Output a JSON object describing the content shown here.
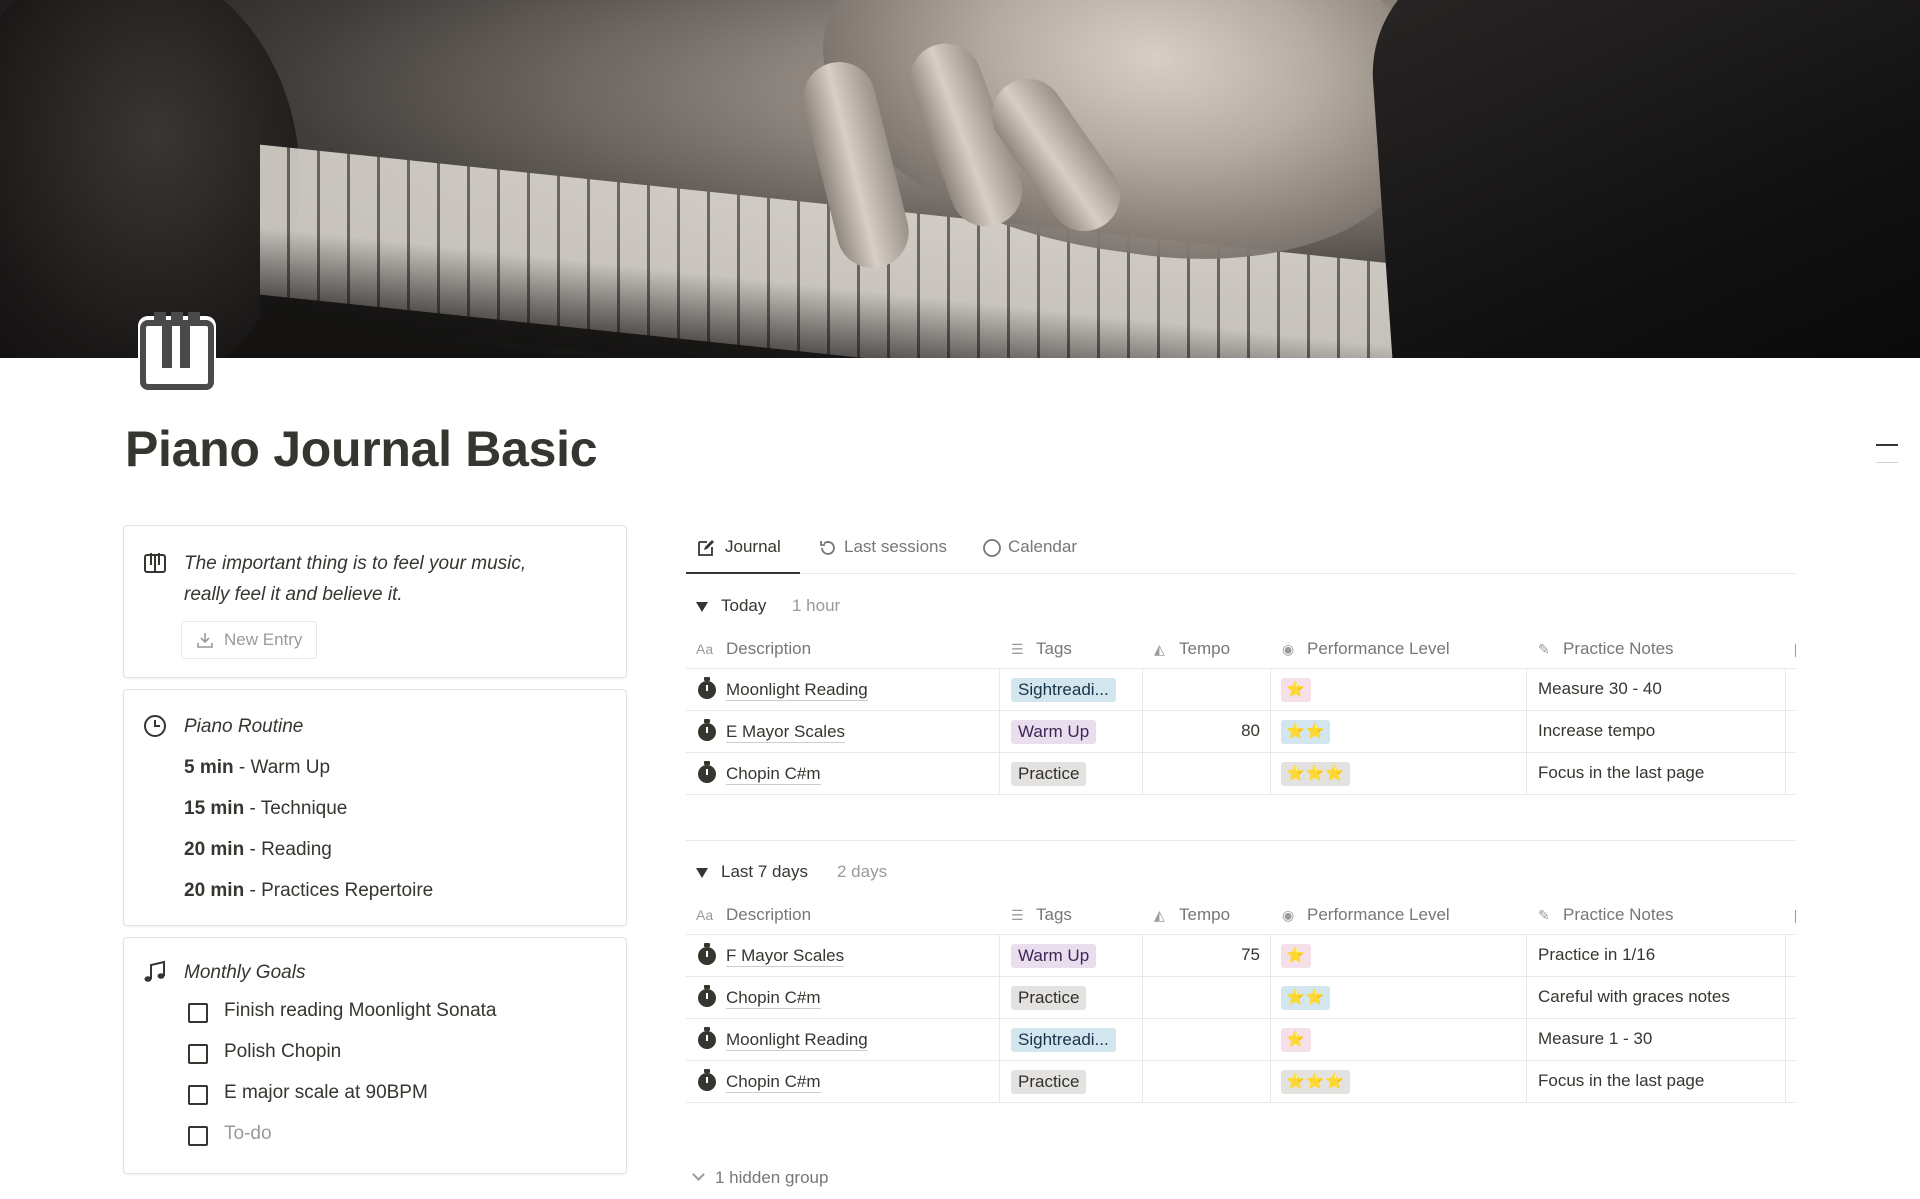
{
  "page": {
    "title": "Piano Journal Basic",
    "icon": "piano-keys-icon"
  },
  "quote_card": {
    "quote_line1": "The important thing is to feel your music,",
    "quote_line2": "really feel it and believe it.",
    "new_entry_label": "New Entry",
    "icon": "piano-keys-icon"
  },
  "routine_card": {
    "heading": "Piano Routine",
    "icon": "clock-icon",
    "items": [
      {
        "duration": "5 min",
        "activity": " - Warm Up"
      },
      {
        "duration": "15 min",
        "activity": " - Technique"
      },
      {
        "duration": "20 min",
        "activity": " - Reading"
      },
      {
        "duration": "20 min",
        "activity": " - Practices Repertoire"
      }
    ]
  },
  "goals_card": {
    "heading": "Monthly Goals",
    "icon": "music-note-icon",
    "goals": [
      {
        "label": "Finish reading Moonlight Sonata",
        "checked": false
      },
      {
        "label": "Polish Chopin",
        "checked": false
      },
      {
        "label": "E major scale at 90BPM",
        "checked": false
      }
    ],
    "placeholder": "To-do"
  },
  "tabs": [
    {
      "label": "Journal",
      "icon": "edit-icon",
      "active": true
    },
    {
      "label": "Last sessions",
      "icon": "history-icon",
      "active": false
    },
    {
      "label": "Calendar",
      "icon": "circle-icon",
      "active": false
    }
  ],
  "columns": [
    {
      "label": "Description",
      "icon": "Aa"
    },
    {
      "label": "Tags",
      "icon": "list-icon"
    },
    {
      "label": "Tempo",
      "icon": "metronome-icon"
    },
    {
      "label": "Performance Level",
      "icon": "status-icon"
    },
    {
      "label": "Practice Notes",
      "icon": "edit-icon"
    }
  ],
  "groups": [
    {
      "name": "Today",
      "count": "1 hour",
      "rows": [
        {
          "description": "Moonlight Reading",
          "tag": "Sightreadi...",
          "tag_color": "#d3e5ef",
          "tempo": "",
          "stars": "⭐",
          "stars_count": 1,
          "notes": "Measure 30 - 40",
          "extra": "I"
        },
        {
          "description": " E Mayor Scales",
          "tag": "Warm Up",
          "tag_color": "#e8deee",
          "tempo": "80",
          "stars": "⭐⭐",
          "stars_count": 2,
          "notes": "Increase tempo",
          "extra": "I"
        },
        {
          "description": "Chopin C#m",
          "tag": "Practice",
          "tag_color": "#e3e2e0",
          "tempo": "",
          "stars": "⭐⭐⭐",
          "stars_count": 3,
          "notes": "Focus in the last page",
          "extra": "I"
        }
      ]
    },
    {
      "name": "Last 7 days",
      "count": "2 days",
      "rows": [
        {
          "description": " F Mayor Scales",
          "tag": "Warm Up",
          "tag_color": "#e8deee",
          "tempo": "75",
          "stars": "⭐",
          "stars_count": 1,
          "notes": "Practice in 1/16",
          "extra": "I"
        },
        {
          "description": "Chopin C#m",
          "tag": "Practice",
          "tag_color": "#e3e2e0",
          "tempo": "",
          "stars": "⭐⭐",
          "stars_count": 2,
          "notes": "Careful with graces notes",
          "extra": "I"
        },
        {
          "description": "Moonlight Reading",
          "tag": "Sightreadi...",
          "tag_color": "#d3e5ef",
          "tempo": "",
          "stars": "⭐",
          "stars_count": 1,
          "notes": "Measure 1 - 30",
          "extra": "I"
        },
        {
          "description": "Chopin C#m",
          "tag": "Practice",
          "tag_color": "#e3e2e0",
          "tempo": "",
          "stars": "⭐⭐⭐",
          "stars_count": 3,
          "notes": "Focus in the last page",
          "extra": "I"
        }
      ]
    }
  ],
  "hidden_groups_label": "1 hidden group"
}
